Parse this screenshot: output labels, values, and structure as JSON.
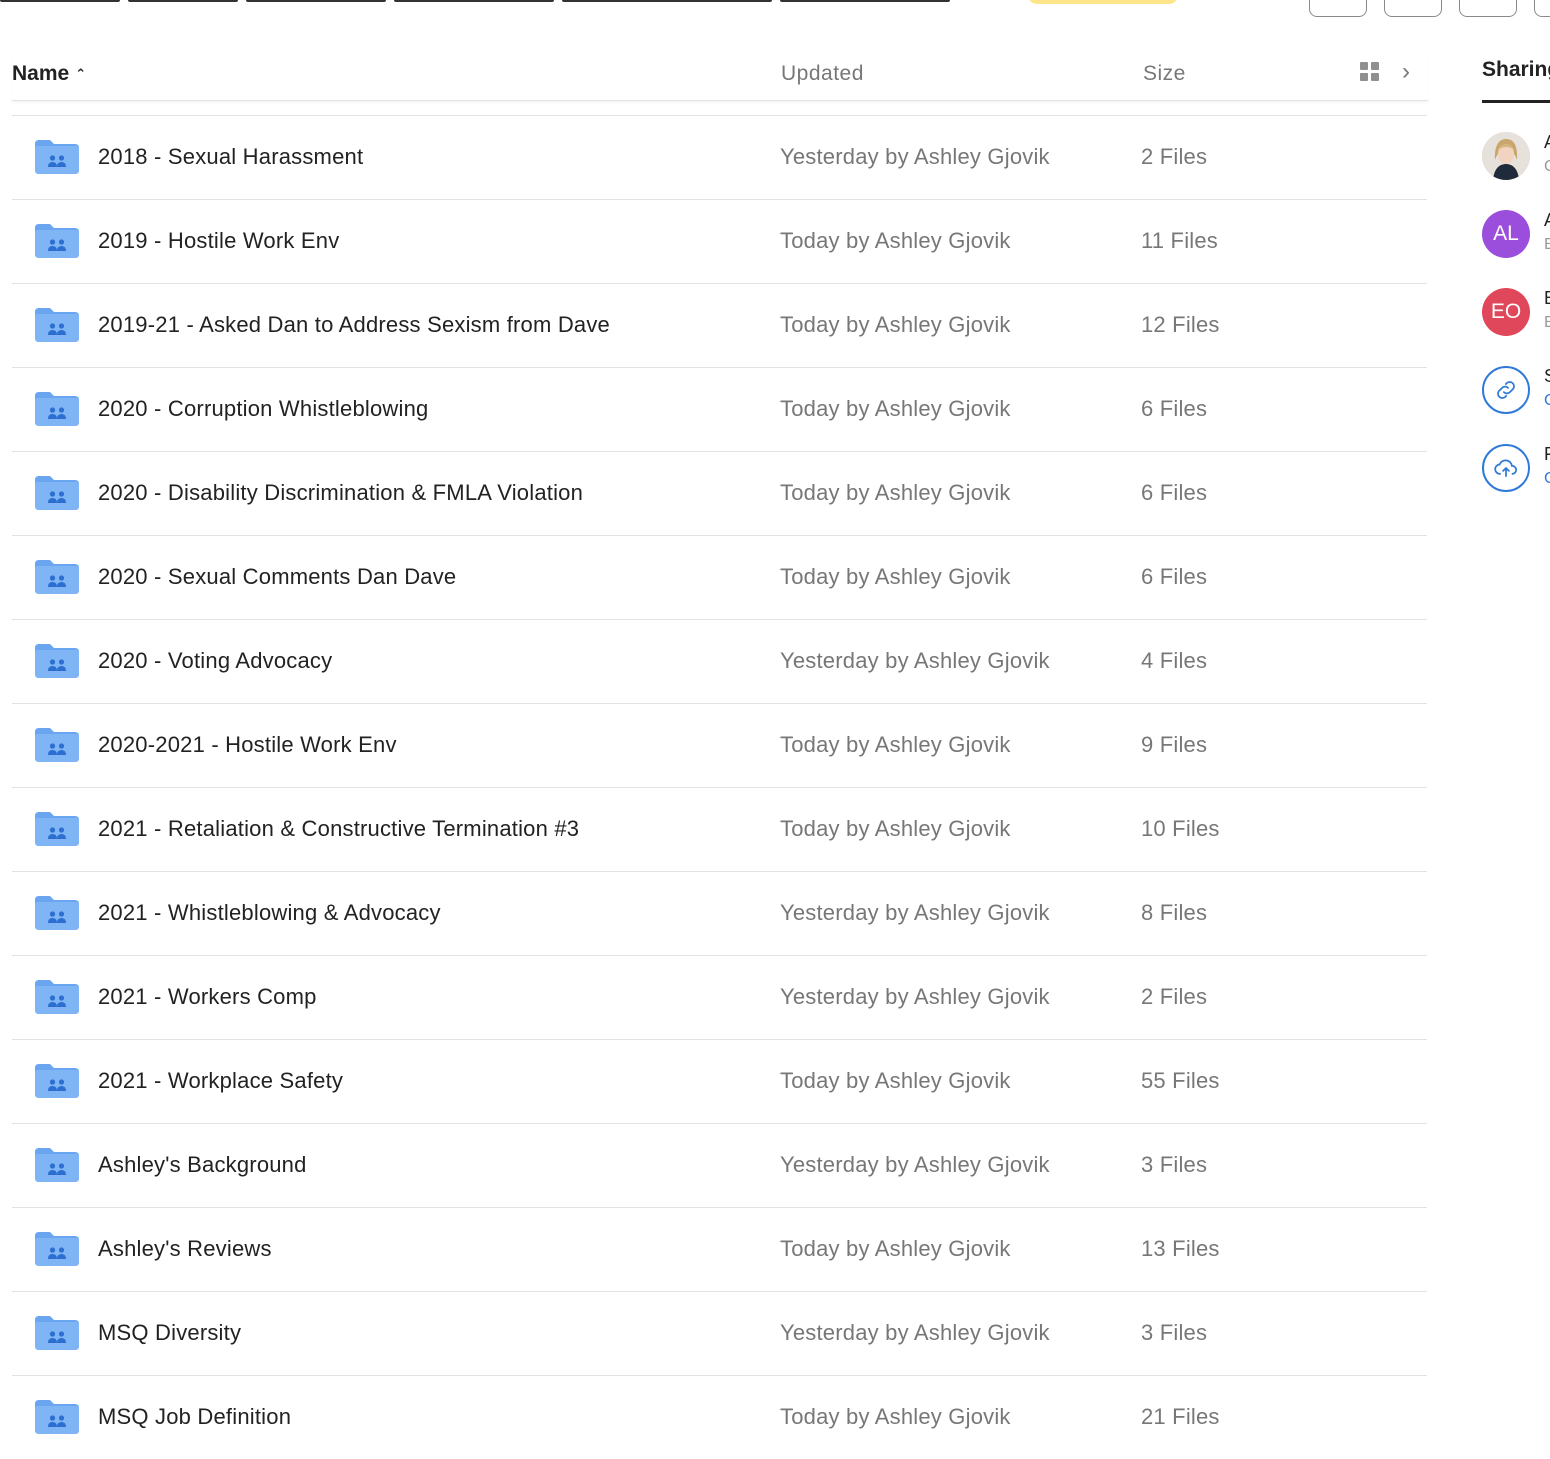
{
  "header": {
    "name_label": "Name",
    "updated_label": "Updated",
    "size_label": "Size"
  },
  "sidebar": {
    "tab_label": "Sharing",
    "people": [
      {
        "initials": "",
        "color": "#d8d3cc"
      },
      {
        "initials": "AL",
        "color": "#9b4ddb"
      },
      {
        "initials": "EO",
        "color": "#e0475a"
      }
    ]
  },
  "folders": [
    {
      "name": "2018 - Sexual Harassment",
      "updated": "Yesterday by Ashley Gjovik",
      "size": "2 Files"
    },
    {
      "name": "2019 - Hostile Work Env",
      "updated": "Today by Ashley Gjovik",
      "size": "11 Files"
    },
    {
      "name": "2019-21 - Asked Dan to Address Sexism from Dave",
      "updated": "Today by Ashley Gjovik",
      "size": "12 Files"
    },
    {
      "name": "2020 - Corruption Whistleblowing",
      "updated": "Today by Ashley Gjovik",
      "size": "6 Files"
    },
    {
      "name": "2020 - Disability Discrimination & FMLA Violation",
      "updated": "Today by Ashley Gjovik",
      "size": "6 Files"
    },
    {
      "name": "2020 - Sexual Comments Dan Dave",
      "updated": "Today by Ashley Gjovik",
      "size": "6 Files"
    },
    {
      "name": "2020 - Voting Advocacy",
      "updated": "Yesterday by Ashley Gjovik",
      "size": "4 Files"
    },
    {
      "name": "2020-2021 - Hostile Work Env",
      "updated": "Today by Ashley Gjovik",
      "size": "9 Files"
    },
    {
      "name": "2021 - Retaliation & Constructive Termination #3",
      "updated": "Today by Ashley Gjovik",
      "size": "10 Files"
    },
    {
      "name": "2021 - Whistleblowing & Advocacy",
      "updated": "Yesterday by Ashley Gjovik",
      "size": "8 Files"
    },
    {
      "name": "2021 - Workers Comp",
      "updated": "Yesterday by Ashley Gjovik",
      "size": "2 Files"
    },
    {
      "name": "2021 - Workplace Safety",
      "updated": "Today by Ashley Gjovik",
      "size": "55 Files"
    },
    {
      "name": "Ashley's Background",
      "updated": "Yesterday by Ashley Gjovik",
      "size": "3 Files"
    },
    {
      "name": "Ashley's Reviews",
      "updated": "Today by Ashley Gjovik",
      "size": "13 Files"
    },
    {
      "name": "MSQ Diversity",
      "updated": "Yesterday by Ashley Gjovik",
      "size": "3 Files"
    },
    {
      "name": "MSQ Job Definition",
      "updated": "Today by Ashley Gjovik",
      "size": "21 Files"
    }
  ]
}
